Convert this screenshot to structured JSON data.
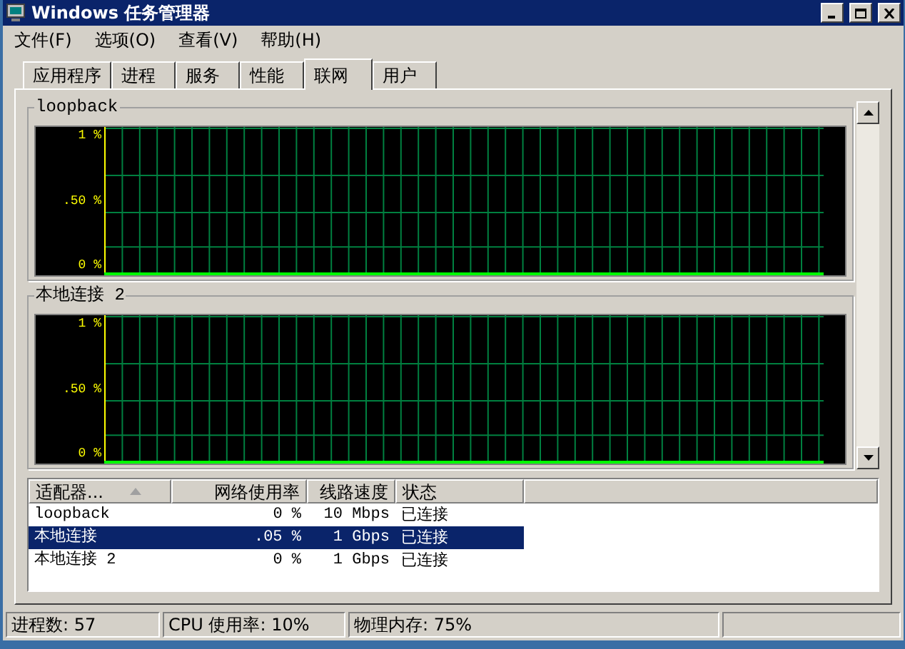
{
  "window": {
    "title": "Windows 任务管理器"
  },
  "menu": [
    "文件(F)",
    "选项(O)",
    "查看(V)",
    "帮助(H)"
  ],
  "tabs": [
    {
      "label": "应用程序",
      "selected": false
    },
    {
      "label": "进程",
      "selected": false
    },
    {
      "label": "服务",
      "selected": false
    },
    {
      "label": "性能",
      "selected": false
    },
    {
      "label": "联网",
      "selected": true
    },
    {
      "label": "用户",
      "selected": false
    }
  ],
  "graphs": [
    {
      "title": "loopback",
      "axis_labels": [
        "1 %",
        ".50 %",
        "0 %"
      ]
    },
    {
      "title": "本地连接 2",
      "axis_labels": [
        "1 %",
        ".50 %",
        "0 %"
      ]
    }
  ],
  "table": {
    "columns": [
      {
        "label": "适配器...",
        "sorted": true
      },
      {
        "label": "网络使用率",
        "sorted": false
      },
      {
        "label": "线路速度",
        "sorted": false
      },
      {
        "label": "状态",
        "sorted": false
      }
    ],
    "rows": [
      {
        "cells": [
          "loopback",
          "0 %",
          "10 Mbps",
          "已连接"
        ],
        "selected": false
      },
      {
        "cells": [
          "本地连接",
          ".05 %",
          "1 Gbps",
          "已连接"
        ],
        "selected": true
      },
      {
        "cells": [
          "本地连接 2",
          "0 %",
          "1 Gbps",
          "已连接"
        ],
        "selected": false
      }
    ]
  },
  "status_bar": [
    "进程数: 57",
    "CPU 使用率: 10%",
    "物理内存: 75%"
  ]
}
